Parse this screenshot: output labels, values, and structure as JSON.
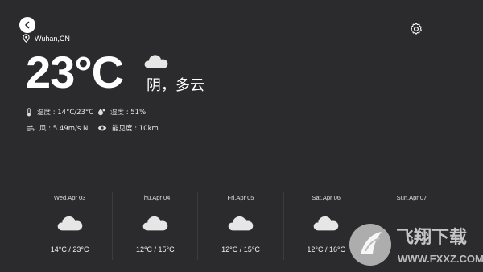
{
  "header": {
    "back_icon": "back-arrow-icon",
    "settings_icon": "gear-icon"
  },
  "location": {
    "name": "Wuhan,CN",
    "icon": "location-pin-icon"
  },
  "current": {
    "temperature": "23°C",
    "condition": "阴，多云",
    "icon": "cloud-icon",
    "details": {
      "temp_range": "温度 : 14°C/23°C",
      "humidity": "湿度 : 51%",
      "wind": "风 : 5.49m/s N",
      "visibility": "能见度 : 10km"
    }
  },
  "forecast": [
    {
      "date": "Wed,Apr 03",
      "range": "14°C / 23°C",
      "icon": "cloud-icon"
    },
    {
      "date": "Thu,Apr 04",
      "range": "12°C / 15°C",
      "icon": "cloud-icon"
    },
    {
      "date": "Fri,Apr 05",
      "range": "12°C / 15°C",
      "icon": "cloud-icon"
    },
    {
      "date": "Sat,Apr 06",
      "range": "12°C / 16°C",
      "icon": "cloud-icon"
    },
    {
      "date": "Sun,Apr 07",
      "range": "",
      "icon": "cloud-icon"
    }
  ],
  "watermark": {
    "title": "飞翔下载",
    "url": "WWW.FXXZ.COM"
  },
  "colors": {
    "background": "#2b2b2d",
    "text": "#ffffff",
    "cloud": "#e6e6e6"
  }
}
